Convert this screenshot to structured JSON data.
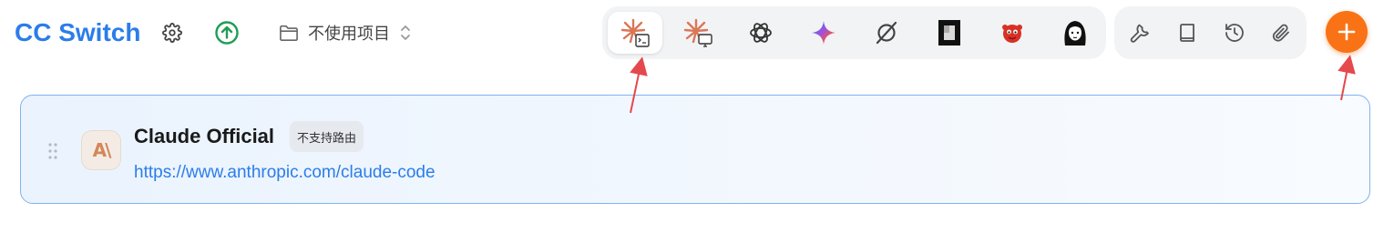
{
  "header": {
    "app_title": "CC Switch",
    "settings_icon": "gear-icon",
    "update_icon": "arrow-up-circle-icon",
    "project": {
      "icon": "folder-icon",
      "label": "不使用项目",
      "chevron_icon": "chevron-updown-icon"
    }
  },
  "apps": [
    {
      "id": "claude-code",
      "icon": "claude-terminal-icon",
      "active": true
    },
    {
      "id": "claude-desktop",
      "icon": "claude-desktop-icon",
      "active": false
    },
    {
      "id": "openai",
      "icon": "openai-icon",
      "active": false
    },
    {
      "id": "gemini",
      "icon": "gemini-sparkle-icon",
      "active": false
    },
    {
      "id": "opencode",
      "icon": "slashed-circle-icon",
      "active": false
    },
    {
      "id": "terminal-app",
      "icon": "black-square-app-icon",
      "active": false
    },
    {
      "id": "red-mascot",
      "icon": "red-mascot-icon",
      "active": false
    },
    {
      "id": "girl-avatar",
      "icon": "girl-avatar-icon",
      "active": false
    }
  ],
  "utilities": [
    "wrench-icon",
    "book-icon",
    "history-icon",
    "paperclip-icon"
  ],
  "add_button": {
    "icon": "plus-icon"
  },
  "provider": {
    "name": "Claude Official",
    "badge": "不支持路由",
    "url": "https://www.anthropic.com/claude-code",
    "logo_icon": "anthropic-logo-icon",
    "drag_icon": "drag-handle-icon"
  },
  "colors": {
    "accent": "#2b7de9",
    "add": "#f97316",
    "annotation": "#e5484d"
  }
}
